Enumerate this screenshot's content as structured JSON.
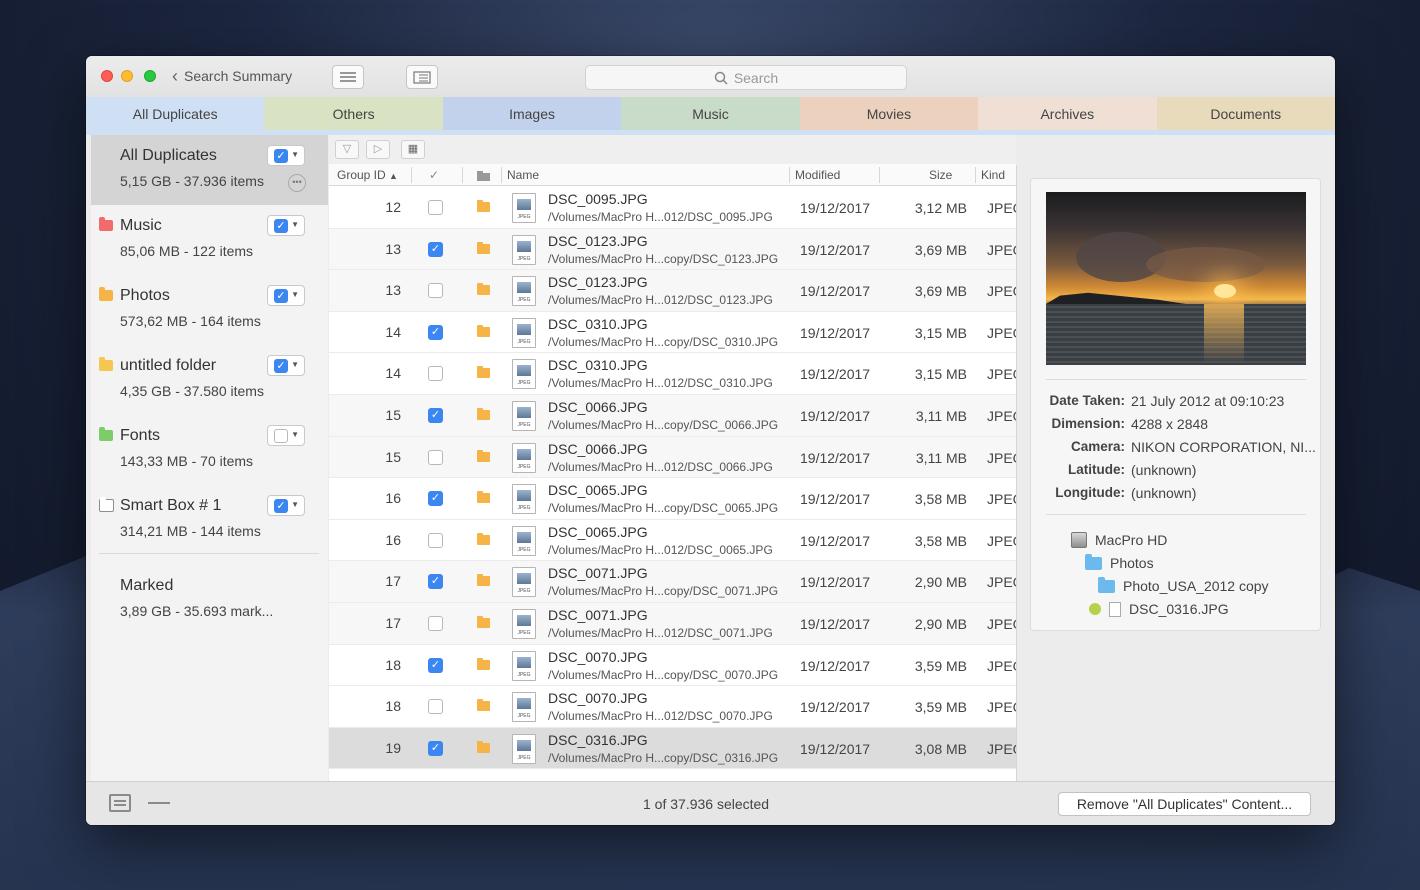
{
  "window": {
    "back_label": "Search Summary",
    "search_placeholder": "Search"
  },
  "tabs": [
    {
      "label": "All Duplicates",
      "color": "#cfe0f5"
    },
    {
      "label": "Others",
      "color": "#d9e2c2"
    },
    {
      "label": "Images",
      "color": "#c3d2ec"
    },
    {
      "label": "Music",
      "color": "#c9dcc9"
    },
    {
      "label": "Movies",
      "color": "#ebd1be"
    },
    {
      "label": "Archives",
      "color": "#efdfd4"
    },
    {
      "label": "Documents",
      "color": "#e7dbbb"
    }
  ],
  "sidebar": {
    "items": [
      {
        "name": "All Duplicates",
        "info": "5,15 GB - 37.936 items",
        "checked": true,
        "selected": true,
        "icon": "none",
        "color": ""
      },
      {
        "name": "Music",
        "info": "85,06 MB - 122 items",
        "checked": true,
        "selected": false,
        "icon": "folder-icon",
        "color": "#f26a6a"
      },
      {
        "name": "Photos",
        "info": "573,62 MB - 164 items",
        "checked": true,
        "selected": false,
        "icon": "folder-icon",
        "color": "#f6b446"
      },
      {
        "name": "untitled folder",
        "info": "4,35 GB - 37.580 items",
        "checked": true,
        "selected": false,
        "icon": "folder-icon",
        "color": "#f6c653"
      },
      {
        "name": "Fonts",
        "info": "143,33 MB - 70 items",
        "checked": false,
        "selected": false,
        "icon": "folder-icon",
        "color": "#7ccd6a"
      },
      {
        "name": "Smart Box # 1",
        "info": "314,21 MB - 144 items",
        "checked": true,
        "selected": false,
        "icon": "smart-box-icon",
        "color": "#8d8d8d"
      },
      {
        "name": "Marked",
        "info": "3,89 GB - 35.693 mark...",
        "checked": null,
        "selected": false,
        "icon": "none",
        "color": ""
      }
    ]
  },
  "list": {
    "columns": {
      "group_id": "Group ID",
      "check": "✓",
      "name": "Name",
      "modified": "Modified",
      "size": "Size",
      "kind": "Kind"
    },
    "rows": [
      {
        "gid": "12",
        "checked": false,
        "name": "DSC_0095.JPG",
        "path": "/Volumes/MacPro H...012/DSC_0095.JPG",
        "modified": "19/12/2017",
        "size": "3,12 MB",
        "kind": "JPEG"
      },
      {
        "gid": "13",
        "checked": true,
        "name": "DSC_0123.JPG",
        "path": "/Volumes/MacPro H...copy/DSC_0123.JPG",
        "modified": "19/12/2017",
        "size": "3,69 MB",
        "kind": "JPEG"
      },
      {
        "gid": "13",
        "checked": false,
        "name": "DSC_0123.JPG",
        "path": "/Volumes/MacPro H...012/DSC_0123.JPG",
        "modified": "19/12/2017",
        "size": "3,69 MB",
        "kind": "JPEG"
      },
      {
        "gid": "14",
        "checked": true,
        "name": "DSC_0310.JPG",
        "path": "/Volumes/MacPro H...copy/DSC_0310.JPG",
        "modified": "19/12/2017",
        "size": "3,15 MB",
        "kind": "JPEG"
      },
      {
        "gid": "14",
        "checked": false,
        "name": "DSC_0310.JPG",
        "path": "/Volumes/MacPro H...012/DSC_0310.JPG",
        "modified": "19/12/2017",
        "size": "3,15 MB",
        "kind": "JPEG"
      },
      {
        "gid": "15",
        "checked": true,
        "name": "DSC_0066.JPG",
        "path": "/Volumes/MacPro H...copy/DSC_0066.JPG",
        "modified": "19/12/2017",
        "size": "3,11 MB",
        "kind": "JPEG"
      },
      {
        "gid": "15",
        "checked": false,
        "name": "DSC_0066.JPG",
        "path": "/Volumes/MacPro H...012/DSC_0066.JPG",
        "modified": "19/12/2017",
        "size": "3,11 MB",
        "kind": "JPEG"
      },
      {
        "gid": "16",
        "checked": true,
        "name": "DSC_0065.JPG",
        "path": "/Volumes/MacPro H...copy/DSC_0065.JPG",
        "modified": "19/12/2017",
        "size": "3,58 MB",
        "kind": "JPEG"
      },
      {
        "gid": "16",
        "checked": false,
        "name": "DSC_0065.JPG",
        "path": "/Volumes/MacPro H...012/DSC_0065.JPG",
        "modified": "19/12/2017",
        "size": "3,58 MB",
        "kind": "JPEG"
      },
      {
        "gid": "17",
        "checked": true,
        "name": "DSC_0071.JPG",
        "path": "/Volumes/MacPro H...copy/DSC_0071.JPG",
        "modified": "19/12/2017",
        "size": "2,90 MB",
        "kind": "JPEG"
      },
      {
        "gid": "17",
        "checked": false,
        "name": "DSC_0071.JPG",
        "path": "/Volumes/MacPro H...012/DSC_0071.JPG",
        "modified": "19/12/2017",
        "size": "2,90 MB",
        "kind": "JPEG"
      },
      {
        "gid": "18",
        "checked": true,
        "name": "DSC_0070.JPG",
        "path": "/Volumes/MacPro H...copy/DSC_0070.JPG",
        "modified": "19/12/2017",
        "size": "3,59 MB",
        "kind": "JPEG"
      },
      {
        "gid": "18",
        "checked": false,
        "name": "DSC_0070.JPG",
        "path": "/Volumes/MacPro H...012/DSC_0070.JPG",
        "modified": "19/12/2017",
        "size": "3,59 MB",
        "kind": "JPEG"
      },
      {
        "gid": "19",
        "checked": true,
        "name": "DSC_0316.JPG",
        "path": "/Volumes/MacPro H...copy/DSC_0316.JPG",
        "modified": "19/12/2017",
        "size": "3,08 MB",
        "kind": "JPEG",
        "selected": true
      }
    ]
  },
  "detail": {
    "meta": [
      {
        "key": "Date Taken:",
        "value": "21 July 2012 at 09:10:23"
      },
      {
        "key": "Dimension:",
        "value": "4288 x 2848"
      },
      {
        "key": "Camera:",
        "value": "NIKON CORPORATION, NI..."
      },
      {
        "key": "Latitude:",
        "value": "(unknown)"
      },
      {
        "key": "Longitude:",
        "value": "(unknown)"
      }
    ],
    "tree": {
      "volume": "MacPro HD",
      "folder1": "Photos",
      "folder2": "Photo_USA_2012 copy",
      "file": "DSC_0316.JPG"
    }
  },
  "bottom": {
    "status": "1 of 37.936 selected",
    "remove_label": "Remove \"All Duplicates\" Content..."
  }
}
